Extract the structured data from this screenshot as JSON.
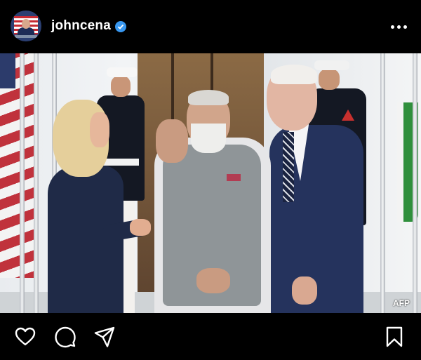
{
  "post": {
    "username": "johncena",
    "verified": true,
    "avatar_icon": "profile-avatar",
    "more_icon": "more-options-icon",
    "photo": {
      "watermark": "AFP"
    },
    "actions": {
      "like_icon": "heart-icon",
      "comment_icon": "comment-icon",
      "share_icon": "send-icon",
      "save_icon": "bookmark-icon"
    },
    "colors": {
      "background": "#000000",
      "text": "#ffffff",
      "verified_badge": "#3897f0"
    }
  }
}
